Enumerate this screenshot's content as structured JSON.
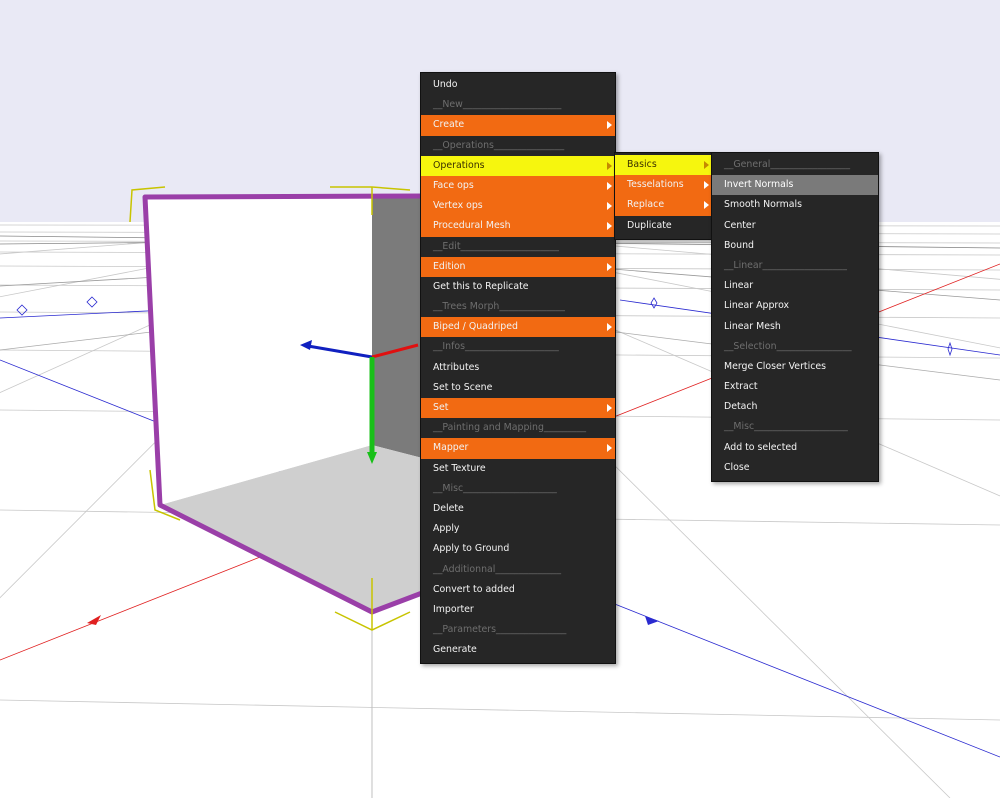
{
  "main_menu": {
    "items": [
      {
        "label": "Undo",
        "type": "item"
      },
      {
        "label": "__New_____________________",
        "type": "sep"
      },
      {
        "label": "Create",
        "type": "sub"
      },
      {
        "label": "__Operations_______________",
        "type": "sep"
      },
      {
        "label": "Operations",
        "type": "hl"
      },
      {
        "label": "Face ops",
        "type": "sub"
      },
      {
        "label": "Vertex ops",
        "type": "sub"
      },
      {
        "label": "Procedural Mesh",
        "type": "sub"
      },
      {
        "label": "__Edit_____________________",
        "type": "sep"
      },
      {
        "label": "Edition",
        "type": "sub"
      },
      {
        "label": "Get this to Replicate",
        "type": "item"
      },
      {
        "label": "__Trees Morph______________",
        "type": "sep"
      },
      {
        "label": "Biped / Quadriped",
        "type": "sub"
      },
      {
        "label": "__Infos____________________",
        "type": "sep"
      },
      {
        "label": "Attributes",
        "type": "item"
      },
      {
        "label": "Set to Scene",
        "type": "item"
      },
      {
        "label": "Set",
        "type": "sub"
      },
      {
        "label": "__Painting and Mapping_________",
        "type": "sep"
      },
      {
        "label": "Mapper",
        "type": "sub"
      },
      {
        "label": "Set Texture",
        "type": "item"
      },
      {
        "label": "__Misc____________________",
        "type": "sep"
      },
      {
        "label": "Delete",
        "type": "item"
      },
      {
        "label": "Apply",
        "type": "item"
      },
      {
        "label": "Apply to Ground",
        "type": "item"
      },
      {
        "label": "__Additionnal______________",
        "type": "sep"
      },
      {
        "label": "Convert to added",
        "type": "item"
      },
      {
        "label": "Importer",
        "type": "item"
      },
      {
        "label": "__Parameters_______________",
        "type": "sep"
      },
      {
        "label": "Generate",
        "type": "item"
      }
    ]
  },
  "operations_menu": {
    "items": [
      {
        "label": "Basics",
        "type": "hl"
      },
      {
        "label": "Tesselations",
        "type": "sub"
      },
      {
        "label": "Replace",
        "type": "sub"
      },
      {
        "label": "Duplicate",
        "type": "item"
      }
    ]
  },
  "basics_menu": {
    "items": [
      {
        "label": "__General_________________",
        "type": "sep"
      },
      {
        "label": "Invert Normals",
        "type": "sel"
      },
      {
        "label": "Smooth Normals",
        "type": "item"
      },
      {
        "label": "Center",
        "type": "item"
      },
      {
        "label": "Bound",
        "type": "item"
      },
      {
        "label": "__Linear__________________",
        "type": "sep"
      },
      {
        "label": "Linear",
        "type": "item"
      },
      {
        "label": "Linear Approx",
        "type": "item"
      },
      {
        "label": "Linear Mesh",
        "type": "item"
      },
      {
        "label": "__Selection________________",
        "type": "sep"
      },
      {
        "label": "Merge Closer Vertices",
        "type": "item"
      },
      {
        "label": "Extract",
        "type": "item"
      },
      {
        "label": "Detach",
        "type": "item"
      },
      {
        "label": "__Misc____________________",
        "type": "sep"
      },
      {
        "label": "Add to selected",
        "type": "item"
      },
      {
        "label": "Close",
        "type": "item"
      }
    ]
  },
  "colors": {
    "sky": "#e9e9f5",
    "menu_bg": "#262626",
    "submenu_item": "#f26a12",
    "highlight": "#f6f60e",
    "selected": "#7a7a7a",
    "selection_outline": "#9a3fa8",
    "gizmo_x": "#e01010",
    "gizmo_y": "#18c018",
    "gizmo_z": "#1020c0"
  }
}
